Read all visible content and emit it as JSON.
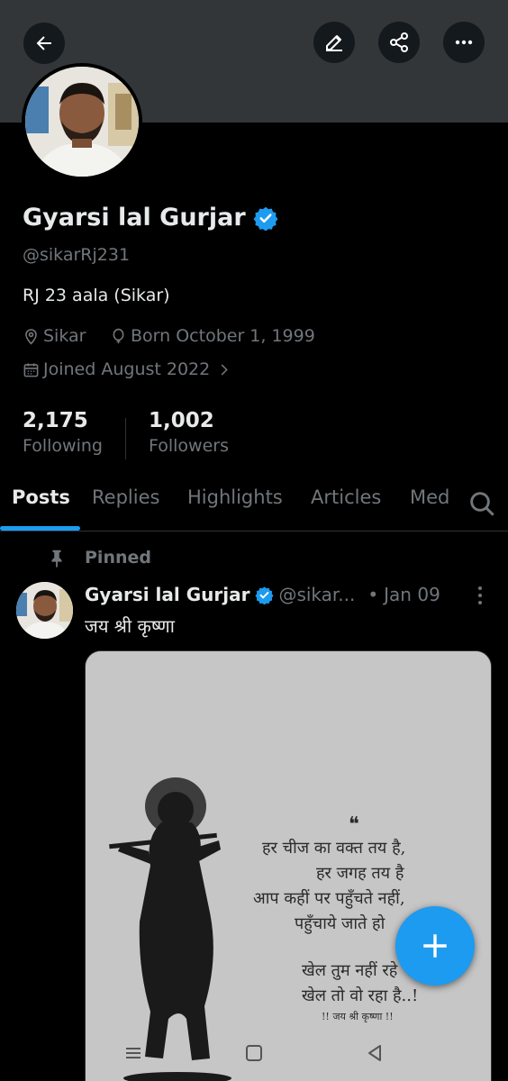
{
  "header": {
    "back_icon": "arrow-left-icon",
    "edit_icon": "pencil-icon",
    "share_icon": "share-icon",
    "more_icon": "more-horizontal-icon"
  },
  "profile": {
    "name": "Gyarsi lal Gurjar",
    "verified": true,
    "handle": "@sikarRj231",
    "bio": "RJ 23 aala (Sikar)",
    "location": "Sikar",
    "born": "Born October 1, 1999",
    "joined": "Joined August 2022"
  },
  "stats": {
    "following_count": "2,175",
    "following_label": "Following",
    "followers_count": "1,002",
    "followers_label": "Followers"
  },
  "tabs": [
    {
      "label": "Posts",
      "active": true
    },
    {
      "label": "Replies",
      "active": false
    },
    {
      "label": "Highlights",
      "active": false
    },
    {
      "label": "Articles",
      "active": false
    },
    {
      "label": "Med",
      "active": false
    }
  ],
  "pinned_label": "Pinned",
  "post": {
    "author_name": "Gyarsi lal Gurjar",
    "author_handle": "@sikar...",
    "separator": "•",
    "date": "Jan 09",
    "text": "जय श्री कृष्णा",
    "image_quote": {
      "mark": "❝",
      "lines": [
        "हर चीज का वक्त तय है,",
        "हर जगह तय है",
        "आप कहीं पर पहुँचते नहीं,",
        "पहुँचाये जाते हो",
        "खेल तुम नहीं रहे",
        "खेल तो वो रहा है..!"
      ],
      "footer": "!! जय श्री कृष्णा !!"
    }
  },
  "colors": {
    "accent": "#1d9bf0",
    "background": "#000000",
    "banner": "#333639",
    "text_primary": "#e7e9ea",
    "text_secondary": "#71767b"
  }
}
